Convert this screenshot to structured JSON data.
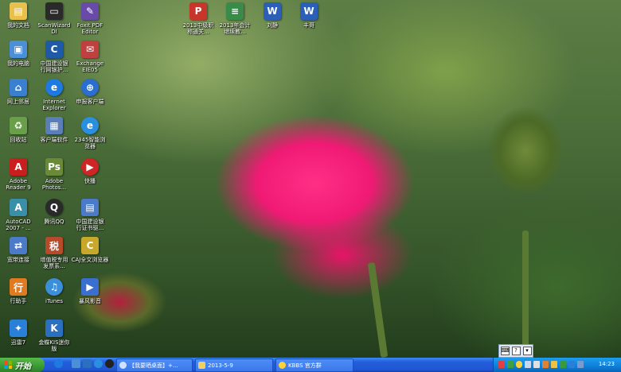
{
  "desktop_icons": [
    {
      "label": "我的文档",
      "icon": "my-documents-icon",
      "color": "#e8c04a"
    },
    {
      "label": "ScanWizard\nDI",
      "icon": "scanner-icon",
      "color": "#2a2a2a"
    },
    {
      "label": "Foxit PDF\nEditor",
      "icon": "pdf-editor-icon",
      "color": "#6a4aa8"
    },
    {
      "label": "2013中级职\n称通关...",
      "icon": "pdf-file-icon",
      "color": "#c8352a"
    },
    {
      "label": "2013年会计\n继续教...",
      "icon": "document-file-icon",
      "color": "#3a8a4a"
    },
    {
      "label": "刘静",
      "icon": "word-file-icon",
      "color": "#2b5fb8"
    },
    {
      "label": "丰哥",
      "icon": "word-file-icon",
      "color": "#2b5fb8"
    },
    {
      "label": "我的电脑",
      "icon": "my-computer-icon",
      "color": "#4a8fd8"
    },
    {
      "label": "中国建设银\n行网银护...",
      "icon": "ccb-security-icon",
      "color": "#1f5aa8"
    },
    {
      "label": "Exchange\nEIE05",
      "icon": "exchange-icon",
      "color": "#c04040"
    },
    {
      "label": "网上邻居",
      "icon": "network-places-icon",
      "color": "#3b7fd0"
    },
    {
      "label": "Internet\nExplorer",
      "icon": "ie-icon",
      "color": "#1e7ae0"
    },
    {
      "label": "申报客户端",
      "icon": "tax-client-icon",
      "color": "#2a6fcf"
    },
    {
      "label": "回收站",
      "icon": "recycle-bin-icon",
      "color": "#6a9f4a"
    },
    {
      "label": "客户端软件",
      "icon": "client-software-icon",
      "color": "#5a7fb8"
    },
    {
      "label": "2345智能浏\n览器",
      "icon": "browser-2345-icon",
      "color": "#2b8fe0"
    },
    {
      "label": "Adobe\nReader 9",
      "icon": "adobe-reader-icon",
      "color": "#c81e1e"
    },
    {
      "label": "Adobe\nPhotos...",
      "icon": "photoshop-icon",
      "color": "#6a8a3a"
    },
    {
      "label": "快播",
      "icon": "qvod-icon",
      "color": "#d02525"
    },
    {
      "label": "AutoCAD\n2007 - ...",
      "icon": "autocad-icon",
      "color": "#3a8fa8"
    },
    {
      "label": "腾讯QQ",
      "icon": "qq-icon",
      "color": "#2a2a2a"
    },
    {
      "label": "中国建设银\n行证书驱...",
      "icon": "ccb-cert-icon",
      "color": "#4a7ac8"
    },
    {
      "label": "宽带连接",
      "icon": "broadband-icon",
      "color": "#4a7ac8"
    },
    {
      "label": "增值税专用\n发票系...",
      "icon": "vat-invoice-icon",
      "color": "#b84a2a"
    },
    {
      "label": "CAJ全文浏览器",
      "icon": "caj-viewer-icon",
      "color": "#c8a82a"
    },
    {
      "label": "行助手",
      "icon": "assistant-icon",
      "color": "#e07a20"
    },
    {
      "label": "iTunes",
      "icon": "itunes-icon",
      "color": "#3a8fd8"
    },
    {
      "label": "暴风影音",
      "icon": "storm-player-icon",
      "color": "#3a6fd0"
    },
    {
      "label": "迅雷7",
      "icon": "thunder-icon",
      "color": "#2a7fd8"
    },
    {
      "label": "金蝶KIS迷你\n版",
      "icon": "kingdee-icon",
      "color": "#2b6fc0"
    }
  ],
  "taskbar": {
    "start_label": "开始",
    "tasks": [
      {
        "label": "【我要晒桌面】+...",
        "icon": "ie-task-icon"
      },
      {
        "label": "2013-5-9",
        "icon": "folder-task-icon"
      },
      {
        "label": "KBBS 官方群",
        "icon": "qq-task-icon"
      }
    ],
    "clock": "14:23"
  },
  "colors": {
    "taskbar": "#245edb",
    "start": "#3c9d34",
    "tray": "#0f7fd9",
    "rose": "#f01a74"
  }
}
